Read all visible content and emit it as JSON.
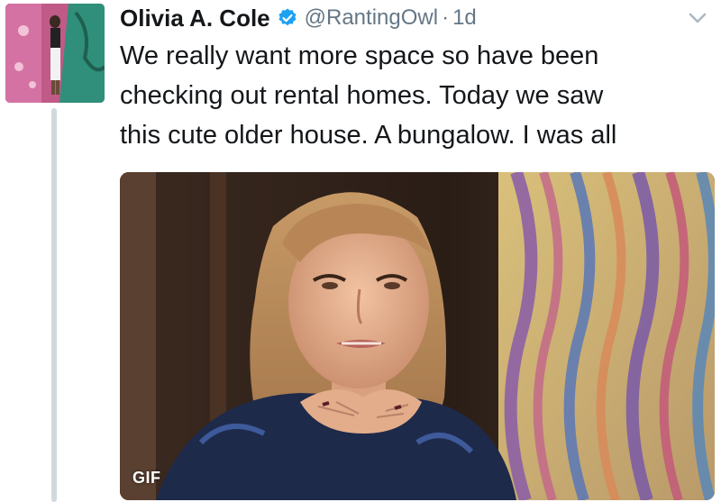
{
  "tweet": {
    "author_name": "Olivia A. Cole",
    "handle": "@RantingOwl",
    "separator": "·",
    "timestamp": "1d",
    "text_lines": [
      "We really want more space so have been",
      "checking out rental homes. Today we saw",
      "this cute older house. A bungalow. I was all"
    ],
    "media": {
      "badge": "GIF"
    }
  },
  "icons": {
    "verified": "verified-badge-icon",
    "menu": "chevron-down-icon"
  },
  "colors": {
    "verified": "#1da1f2",
    "secondary_text": "#657786",
    "thread_line": "#cfd9de"
  }
}
